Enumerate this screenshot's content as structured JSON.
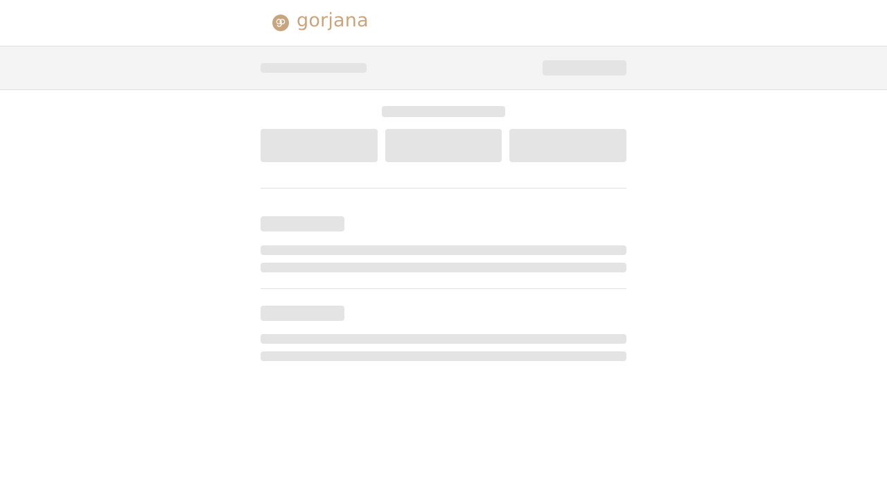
{
  "header": {
    "brand_name": "gorjana",
    "brand_color": "#c9a57f",
    "logo_icon": "gorjana-monogram-icon"
  },
  "colors": {
    "skeleton": "#e4e4e4",
    "summary_bar_background": "#f4f4f4",
    "divider": "#dedede"
  },
  "state": "loading"
}
